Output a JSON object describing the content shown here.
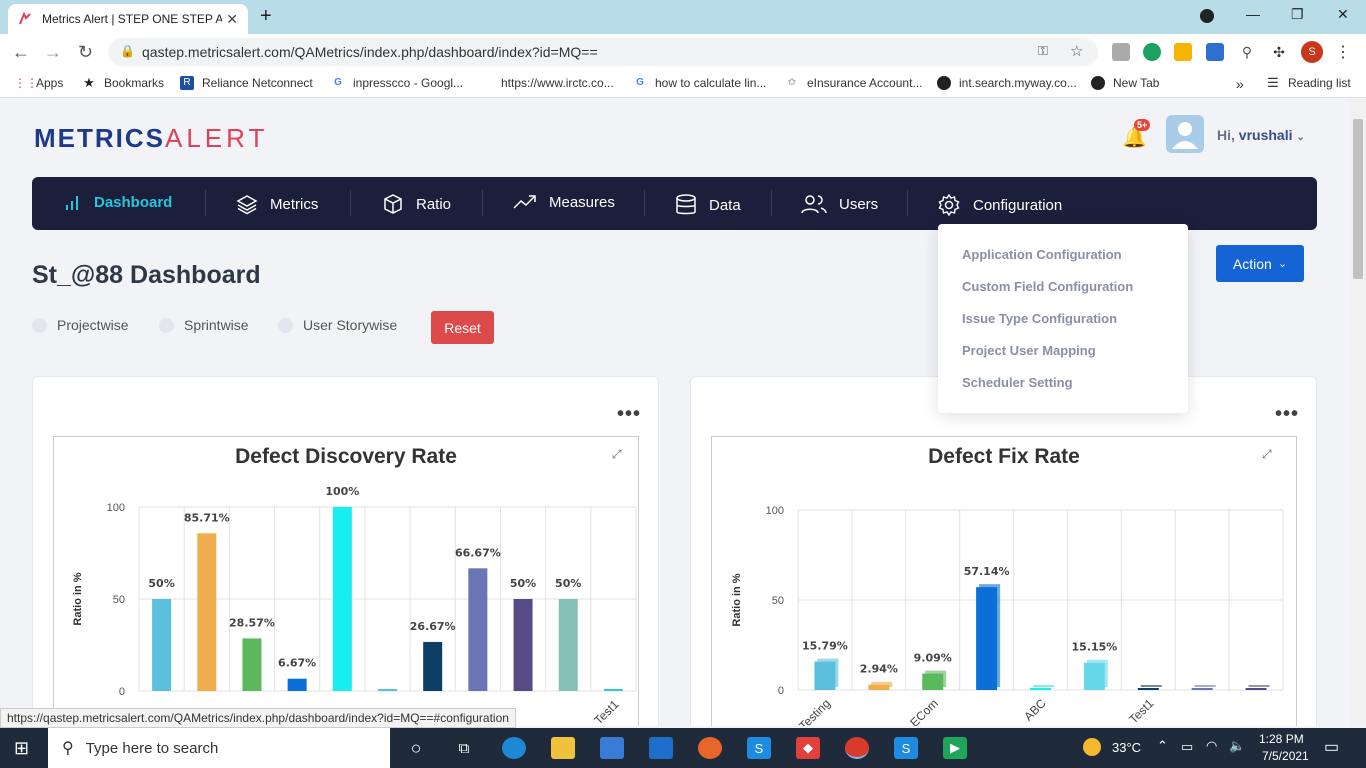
{
  "browser": {
    "tab_title": "Metrics Alert | STEP ONE STEP AH",
    "url": "qastep.metricsalert.com/QAMetrics/index.php/dashboard/index?id=MQ==",
    "status_url": "https://qastep.metricsalert.com/QAMetrics/index.php/dashboard/index?id=MQ==#configuration",
    "bookmarks": [
      {
        "label": "Apps"
      },
      {
        "label": "Bookmarks"
      },
      {
        "label": "Reliance Netconnect"
      },
      {
        "label": "inpresscco - Googl..."
      },
      {
        "label": "https://www.irctc.co..."
      },
      {
        "label": "how to calculate lin..."
      },
      {
        "label": "eInsurance Account..."
      },
      {
        "label": "int.search.myway.co..."
      },
      {
        "label": "New Tab"
      }
    ],
    "more_bookmarks": "»",
    "reading_list": "Reading list"
  },
  "header": {
    "logo_main": "METRICS",
    "logo_alert": "ALERT",
    "notification_badge": "5+",
    "greeting": "Hi,",
    "username": "vrushali"
  },
  "nav": {
    "items": [
      {
        "label": "Dashboard"
      },
      {
        "label": "Metrics"
      },
      {
        "label": "Ratio"
      },
      {
        "label": "Measures"
      },
      {
        "label": "Data"
      },
      {
        "label": "Users"
      },
      {
        "label": "Configuration"
      }
    ]
  },
  "config_menu": {
    "items": [
      {
        "label": "Application Configuration"
      },
      {
        "label": "Custom Field Configuration"
      },
      {
        "label": "Issue Type Configuration"
      },
      {
        "label": "Project User Mapping"
      },
      {
        "label": "Scheduler Setting"
      }
    ]
  },
  "dashboard": {
    "title": "St_@88 Dashboard",
    "action_label": "Action",
    "filters": [
      {
        "label": "Projectwise"
      },
      {
        "label": "Sprintwise"
      },
      {
        "label": "User Storywise"
      }
    ],
    "reset_label": "Reset"
  },
  "chart_data": [
    {
      "type": "bar",
      "title": "Defect Discovery Rate",
      "ylabel": "Ratio in %",
      "ylim": [
        0,
        100
      ],
      "yticks": [
        0,
        50,
        100
      ],
      "categories": [
        "",
        "",
        "",
        "",
        "",
        "",
        "",
        "",
        "",
        "",
        "Test1"
      ],
      "values": [
        50,
        85.71,
        28.57,
        6.67,
        100,
        0,
        26.67,
        66.67,
        50,
        50,
        0
      ],
      "data_labels": [
        "50%",
        "85.71%",
        "28.57%",
        "6.67%",
        "100%",
        "",
        "26.67%",
        "66.67%",
        "50%",
        "50%",
        ""
      ],
      "colors": [
        "#5bc0de",
        "#f0ad4e",
        "#5cb85c",
        "#0b6fd8",
        "#16eef0",
        "#5bc0de",
        "#0d3e66",
        "#6a75b4",
        "#564a87",
        "#85c1b7",
        "#36c6d8"
      ]
    },
    {
      "type": "bar",
      "title": "Defect Fix Rate",
      "ylabel": "Ratio in %",
      "ylim": [
        0,
        100
      ],
      "yticks": [
        0,
        50,
        100
      ],
      "categories": [
        "Testing",
        "",
        "ECom",
        "",
        "ABC",
        "",
        "Test1",
        "",
        ""
      ],
      "values": [
        15.79,
        2.94,
        9.09,
        57.14,
        0,
        15.15,
        0,
        0,
        0
      ],
      "data_labels": [
        "15.79%",
        "2.94%",
        "9.09%",
        "57.14%",
        "",
        "15.15%",
        "",
        "",
        ""
      ],
      "colors": [
        "#5bc0de",
        "#f0ad4e",
        "#5cb85c",
        "#0b6fd8",
        "#16eef0",
        "#67d8ea",
        "#0d3e66",
        "#6a75b4",
        "#564a87"
      ]
    }
  ],
  "taskbar": {
    "search_placeholder": "Type here to search",
    "temperature": "33°C",
    "time": "1:28 PM",
    "date": "7/5/2021"
  }
}
